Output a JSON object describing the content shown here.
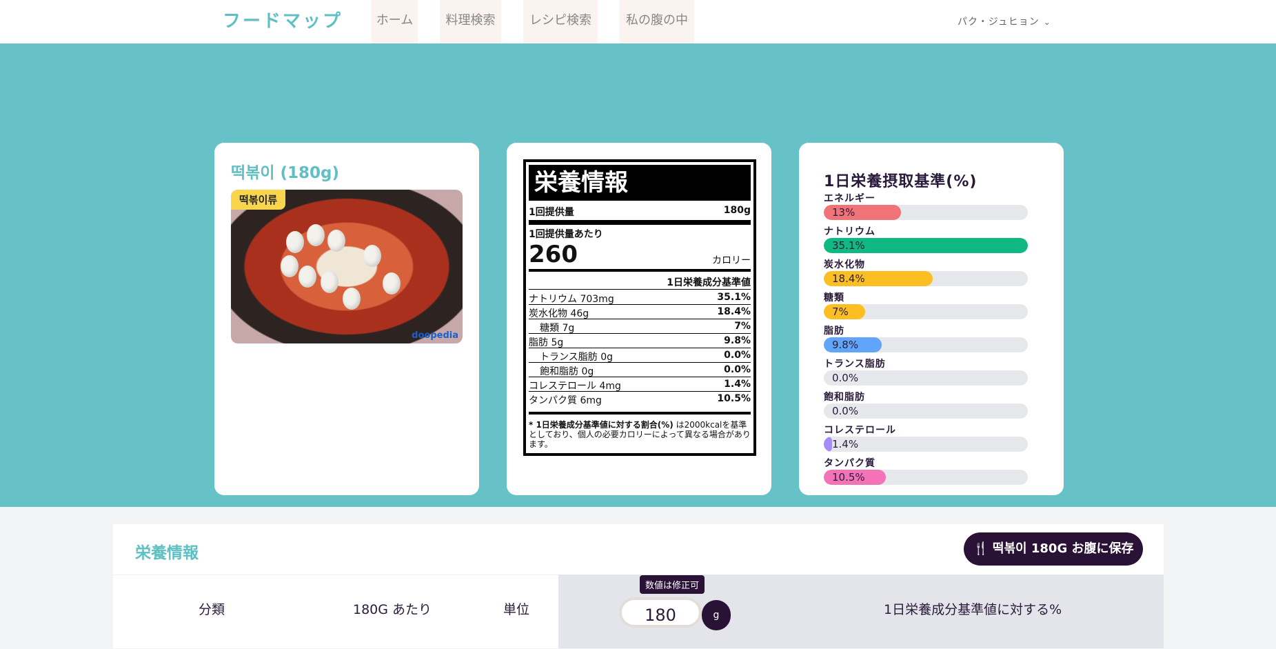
{
  "nav": {
    "brand": "フードマップ",
    "links": [
      "ホーム",
      "料理検索",
      "レシピ検索",
      "私の腹の中"
    ],
    "user": "パク・ジュヒョン"
  },
  "food": {
    "title": "떡볶이 (180g)",
    "category_tag": "떡볶이류",
    "watermark": "doopedia"
  },
  "label": {
    "heading": "栄養情報",
    "serving_size_label": "1回提供量",
    "serving_size": "180g",
    "per_serving": "1回提供量あたり",
    "calories": "260",
    "calories_unit": "カロリー",
    "dv_header": "1日栄養成分基準値",
    "rows": [
      {
        "name": "ナトリウム",
        "amount": "703mg",
        "pct": "35.1%"
      },
      {
        "name": "炭水化物",
        "amount": "46g",
        "pct": "18.4%"
      },
      {
        "name": "糖類",
        "amount": "7g",
        "pct": "7%"
      },
      {
        "name": "脂肪",
        "amount": "5g",
        "pct": "9.8%"
      },
      {
        "name": "トランス脂肪",
        "amount": "0g",
        "pct": "0.0%"
      },
      {
        "name": "飽和脂肪",
        "amount": "0g",
        "pct": "0.0%"
      },
      {
        "name": "コレステロール",
        "amount": "4mg",
        "pct": "1.4%"
      },
      {
        "name": "タンパク質",
        "amount": "6mg",
        "pct": "10.5%"
      }
    ],
    "footnote_bold": "* 1日栄養成分基準値に対する割合(%)",
    "footnote": " は2000kcalを基準としており、個人の必要カロリーによって異なる場合があります。"
  },
  "rdi": {
    "title": "1日栄養摂取基準(%)",
    "items": [
      {
        "label": "エネルギー",
        "pct": "13%",
        "value": 13,
        "color": "#f07378"
      },
      {
        "label": "ナトリウム",
        "pct": "35.1%",
        "value": 35.1,
        "color": "#10b981"
      },
      {
        "label": "炭水化物",
        "pct": "18.4%",
        "value": 18.4,
        "color": "#fbbf24"
      },
      {
        "label": "糖類",
        "pct": "7%",
        "value": 7,
        "color": "#fbbf24"
      },
      {
        "label": "脂肪",
        "pct": "9.8%",
        "value": 9.8,
        "color": "#60a5fa"
      },
      {
        "label": "トランス脂肪",
        "pct": "0.0%",
        "value": 0,
        "color": "#60a5fa"
      },
      {
        "label": "飽和脂肪",
        "pct": "0.0%",
        "value": 0,
        "color": "#60a5fa"
      },
      {
        "label": "コレステロール",
        "pct": "1.4%",
        "value": 1.4,
        "color": "#a78bfa"
      },
      {
        "label": "タンパク質",
        "pct": "10.5%",
        "value": 10.5,
        "color": "#f472b6"
      }
    ]
  },
  "panel": {
    "title": "栄養情報",
    "save_button": "떡볶이 180G お腹に保存",
    "headers": {
      "category": "分類",
      "per": "180G あたり",
      "unit": "単位",
      "dv": "1日栄養成分基準値に対する%"
    },
    "tooltip": "数値は修正可",
    "amount_value": "180",
    "unit_button": "g"
  }
}
